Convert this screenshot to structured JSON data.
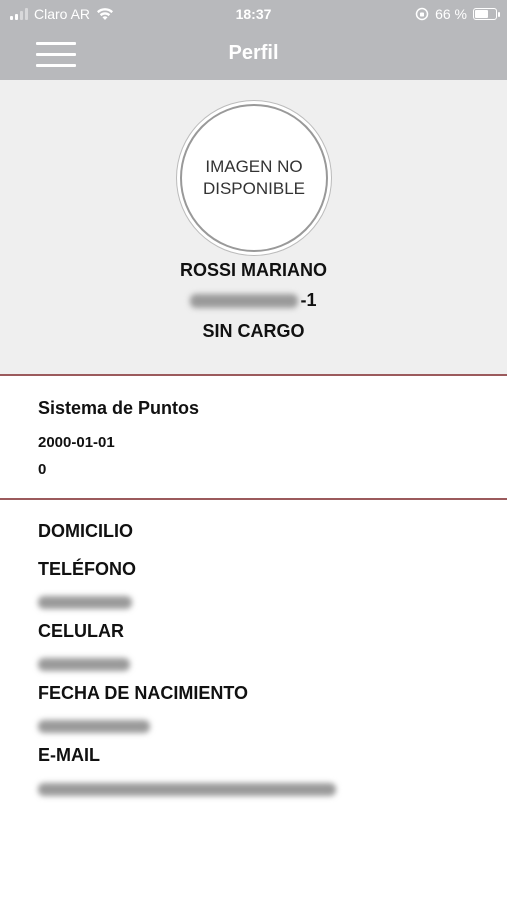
{
  "status_bar": {
    "carrier": "Claro AR",
    "time": "18:37",
    "battery_percent": "66 %",
    "battery_level": 0.66
  },
  "nav": {
    "title": "Perfil",
    "menu_icon": "hamburger-menu-icon"
  },
  "profile": {
    "avatar_text": "IMAGEN NO DISPONIBLE",
    "name": "ROSSI MARIANO",
    "id_suffix": "-1",
    "cargo": "SIN CARGO"
  },
  "points": {
    "title": "Sistema de Puntos",
    "date": "2000-01-01",
    "value": "0"
  },
  "details": {
    "domicilio_label": "DOMICILIO",
    "telefono_label": "TELÉFONO",
    "celular_label": "CELULAR",
    "nacimiento_label": "FECHA DE NACIMIENTO",
    "email_label": "E-MAIL"
  },
  "colors": {
    "header_bg": "#b8b9bc",
    "profile_bg": "#efefef",
    "divider": "#9b5a5c"
  }
}
